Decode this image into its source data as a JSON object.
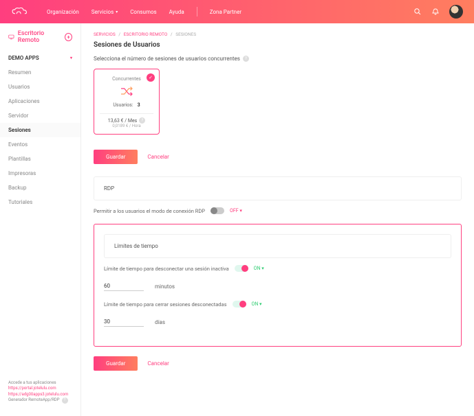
{
  "topbar": {
    "nav": [
      "Organización",
      "Servicios",
      "Consumos",
      "Ayuda",
      "Zona Partner"
    ]
  },
  "sidebar": {
    "title": "Escritorio Remoto",
    "section": "DEMO APPS",
    "items": [
      {
        "label": "Resumen"
      },
      {
        "label": "Usuarios"
      },
      {
        "label": "Aplicaciones"
      },
      {
        "label": "Servidor"
      },
      {
        "label": "Sesiones",
        "active": true
      },
      {
        "label": "Eventos"
      },
      {
        "label": "Plantillas"
      },
      {
        "label": "Impresoras"
      },
      {
        "label": "Backup"
      },
      {
        "label": "Tutoriales"
      }
    ],
    "footer": {
      "heading": "Accede a tus aplicaciones",
      "links": [
        "https://portal.jotelulu.com",
        "https://adg00apps3.jotelulu.com"
      ],
      "gen": "Generador RemoteApp/RDP"
    }
  },
  "breadcrumb": [
    "SERVICIOS",
    "ESCRITORIO REMOTO",
    "SESIONES"
  ],
  "page_title": "Sesiones de Usuarios",
  "select_heading": "Selecciona el número de sesiones de usuarios concurrentes",
  "card": {
    "title": "Concurrentes",
    "users_label": "Usuarios:",
    "users_value": "3",
    "price_month": "13,63 € / Mes",
    "price_hour": "0,0189 € / Hora"
  },
  "buttons": {
    "save": "Guardar",
    "cancel": "Cancelar"
  },
  "rdp": {
    "heading": "RDP",
    "allow_label": "Permitir a los usuarios el modo de conexión RDP",
    "state_off": "OFF"
  },
  "limits": {
    "heading": "Límites de tiempo",
    "inactive_label": "Límite de tiempo para desconectar una sesión inactiva",
    "inactive_value": "60",
    "inactive_unit": "minutos",
    "closed_label": "Límite de tiempo para cerrar sesiones desconectadas",
    "closed_value": "30",
    "closed_unit": "días",
    "state_on": "ON"
  }
}
